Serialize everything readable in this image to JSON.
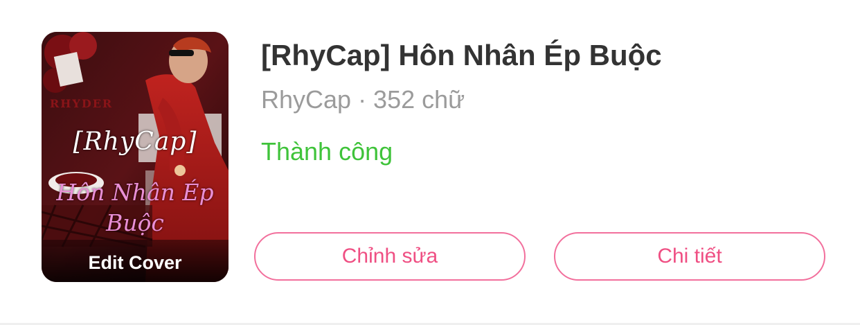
{
  "story": {
    "title": "[RhyCap] Hôn Nhân Ép Buộc",
    "meta": "RhyCap · 352 chữ",
    "status": "Thành công"
  },
  "cover": {
    "title_line": "[RhyCap]",
    "subtitle": "Hôn Nhân Ép Buộc",
    "mark": "RHYDER",
    "edit_label": "Edit Cover"
  },
  "actions": {
    "edit_label": "Chỉnh sửa",
    "detail_label": "Chi tiết"
  },
  "colors": {
    "title": "#333333",
    "meta": "#9b9b9b",
    "status": "#3fc33a",
    "button_border": "#f26f9c",
    "button_text": "#ef4f83"
  }
}
